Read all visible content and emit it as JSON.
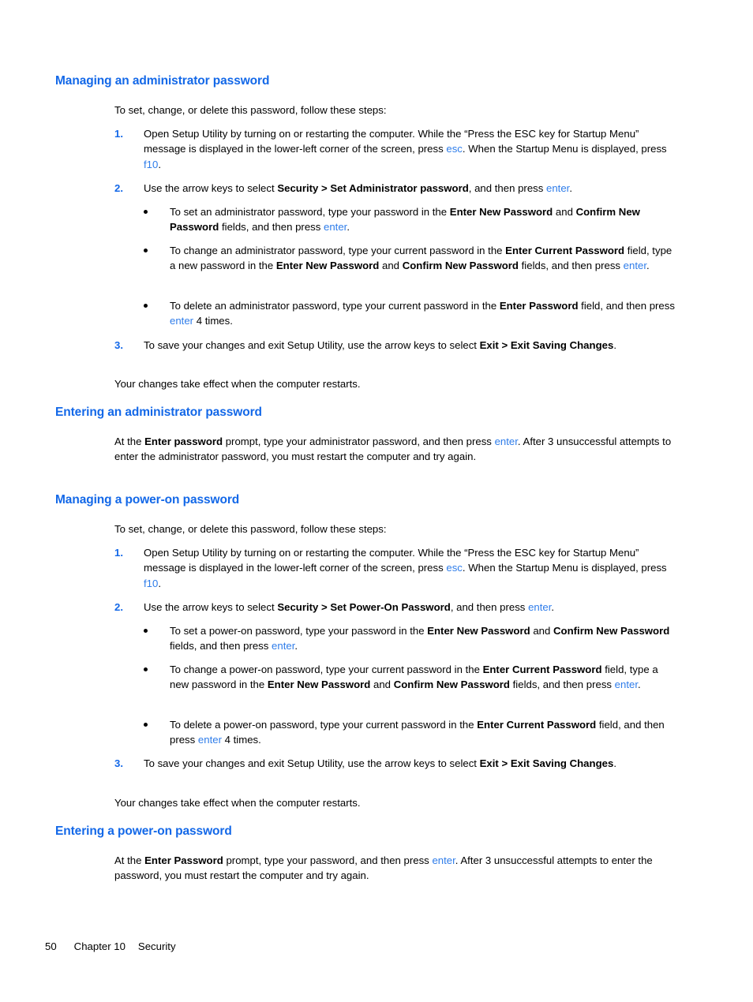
{
  "document": {
    "colors": {
      "heading": "#1368e8",
      "keyboard_link": "#2f7dea",
      "body_text": "#000000",
      "background": "#ffffff"
    }
  },
  "sections": {
    "managing_admin": {
      "heading": "Managing an administrator password",
      "intro": "To set, change, or delete this password, follow these steps:",
      "step1": {
        "number": "1.",
        "t1": "Open Setup Utility by turning on or restarting the computer. While the “Press the ESC key for Startup Menu” message is displayed in the lower-left corner of the screen, press ",
        "key1": "esc",
        "t2": ". When the Startup Menu is displayed, press ",
        "key2": "f10",
        "t3": "."
      },
      "step2": {
        "number": "2.",
        "t1": "Use the arrow keys to select ",
        "b1": "Security > Set Administrator password",
        "t2": ", and then press ",
        "key1": "enter",
        "t3": "."
      },
      "bullets": [
        {
          "t1": "To set an administrator password, type your password in the ",
          "b1": "Enter New Password",
          "t2": " and ",
          "b2": "Confirm New Password",
          "t3": " fields, and then press ",
          "key1": "enter",
          "t4": "."
        },
        {
          "t1": "To change an administrator password, type your current password in the ",
          "b1": "Enter Current Password",
          "t2": " field, type a new password in the ",
          "b2": "Enter New Password",
          "t3": " and ",
          "b3": "Confirm New Password",
          "t4": " fields, and then press ",
          "key1": "enter",
          "t5": "."
        },
        {
          "t1": "To delete an administrator password, type your current password in the ",
          "b1": "Enter Password",
          "t2": " field, and then press ",
          "key1": "enter",
          "t3": " 4 times."
        }
      ],
      "step3": {
        "number": "3.",
        "t1": "To save your changes and exit Setup Utility, use the arrow keys to select ",
        "b1": "Exit > Exit Saving Changes",
        "t2": "."
      },
      "closing": "Your changes take effect when the computer restarts."
    },
    "entering_admin": {
      "heading": "Entering an administrator password",
      "body": {
        "t1": "At the ",
        "b1": "Enter password",
        "t2": " prompt, type your administrator password, and then press ",
        "key1": "enter",
        "t3": ". After 3 unsuccessful attempts to enter the administrator password, you must restart the computer and try again."
      }
    },
    "managing_poweron": {
      "heading": "Managing a power-on password",
      "intro": "To set, change, or delete this password, follow these steps:",
      "step1": {
        "number": "1.",
        "t1": "Open Setup Utility by turning on or restarting the computer. While the “Press the ESC key for Startup Menu” message is displayed in the lower-left corner of the screen, press ",
        "key1": "esc",
        "t2": ". When the Startup Menu is displayed, press ",
        "key2": "f10",
        "t3": "."
      },
      "step2": {
        "number": "2.",
        "t1": "Use the arrow keys to select ",
        "b1": "Security > Set Power-On Password",
        "t2": ", and then press ",
        "key1": "enter",
        "t3": "."
      },
      "bullets": [
        {
          "t1": "To set a power-on password, type your password in the ",
          "b1": "Enter New Password",
          "t2": " and ",
          "b2": "Confirm New Password",
          "t3": " fields, and then press ",
          "key1": "enter",
          "t4": "."
        },
        {
          "t1": "To change a power-on password, type your current password in the ",
          "b1": "Enter Current Password",
          "t2": " field, type a new password in the ",
          "b2": "Enter New Password",
          "t3": " and ",
          "b3": "Confirm New Password",
          "t4": " fields, and then press ",
          "key1": "enter",
          "t5": "."
        },
        {
          "t1": "To delete a power-on password, type your current password in the ",
          "b1": "Enter Current Password",
          "t2": " field, and then press ",
          "key1": "enter",
          "t3": " 4 times."
        }
      ],
      "step3": {
        "number": "3.",
        "t1": "To save your changes and exit Setup Utility, use the arrow keys to select ",
        "b1": "Exit > Exit Saving Changes",
        "t2": "."
      },
      "closing": "Your changes take effect when the computer restarts."
    },
    "entering_poweron": {
      "heading": "Entering a power-on password",
      "body": {
        "t1": "At the ",
        "b1": "Enter Password",
        "t2": " prompt, type your password, and then press ",
        "key1": "enter",
        "t3": ". After 3 unsuccessful attempts to enter the password, you must restart the computer and try again."
      }
    }
  },
  "footer": {
    "page_number": "50",
    "chapter": "Chapter 10",
    "chapter_title": "Security"
  }
}
